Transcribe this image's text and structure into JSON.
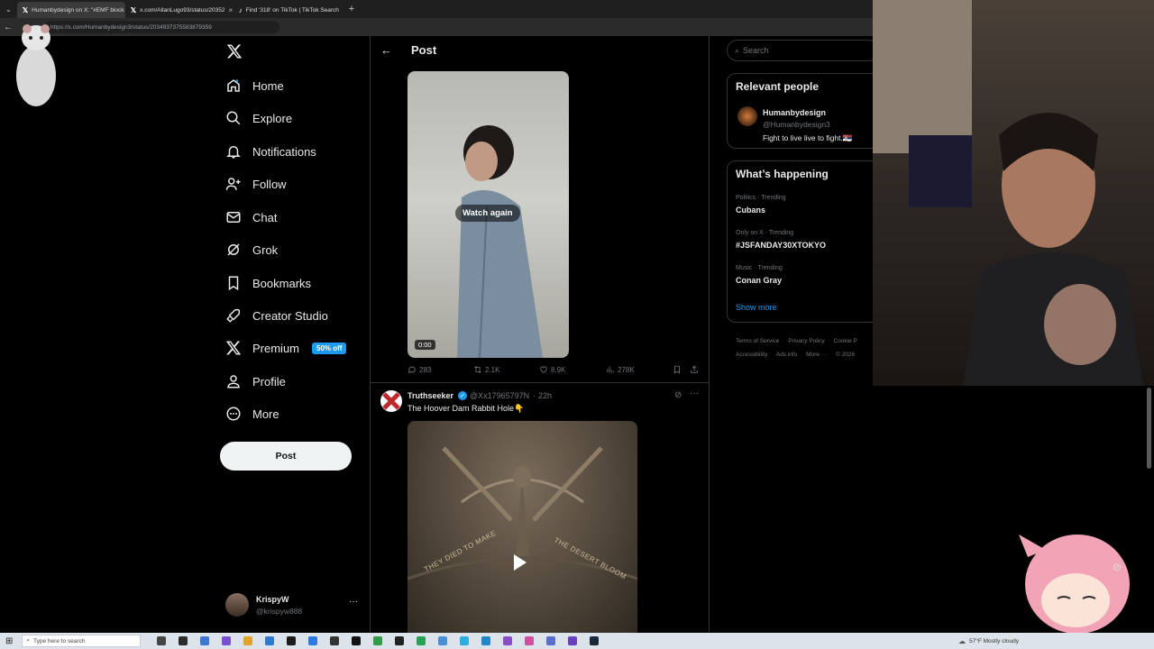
{
  "browser": {
    "tabs": [
      {
        "label": "Humanbydesign on X: \"#EMF block",
        "active": true
      },
      {
        "label": "x.com/AllanLugo93/status/20352",
        "active": false
      },
      {
        "label": "Find '318' on TikTok | TikTok Search",
        "active": false
      }
    ],
    "url": "https://x.com/Humanbydesign3/status/2034937375583879359"
  },
  "nav": {
    "items": [
      {
        "label": "Home",
        "icon": "home-icon"
      },
      {
        "label": "Explore",
        "icon": "search-icon"
      },
      {
        "label": "Notifications",
        "icon": "bell-icon"
      },
      {
        "label": "Follow",
        "icon": "follow-icon"
      },
      {
        "label": "Chat",
        "icon": "mail-icon"
      },
      {
        "label": "Grok",
        "icon": "grok-icon"
      },
      {
        "label": "Bookmarks",
        "icon": "bookmark-icon"
      },
      {
        "label": "Creator Studio",
        "icon": "rocket-icon"
      },
      {
        "label": "Premium",
        "icon": "x-logo-icon"
      },
      {
        "label": "Profile",
        "icon": "person-icon"
      },
      {
        "label": "More",
        "icon": "more-circle-icon"
      }
    ],
    "premium_badge": "50% off",
    "post_label": "Post",
    "account": {
      "name": "KrispyW",
      "handle": "@krispyw888"
    }
  },
  "header": {
    "title": "Post"
  },
  "video1": {
    "overlay": "Watch again",
    "time": "0:00"
  },
  "actions": {
    "replies": "283",
    "reposts": "2.1K",
    "likes": "8.9K",
    "views": "278K"
  },
  "post2": {
    "author": "Truthseeker",
    "handle": "@Xx17965797N",
    "time": "22h",
    "text": "The Hoover Dam Rabbit Hole👇",
    "media_text_left": "THEY DIED TO MAKE",
    "media_text_right": "THE DESERT BLOOM"
  },
  "search": {
    "placeholder": "Search"
  },
  "relevant": {
    "title": "Relevant people",
    "name": "Humanbydesign",
    "handle": "@Humanbydesign3",
    "bio": "Fight to live live to fight.🇷🇸"
  },
  "happening": {
    "title": "What’s happening",
    "trends": [
      {
        "meta": "Politics · Trending",
        "name": "Cubans"
      },
      {
        "meta": "Only on X · Trending",
        "name": "#JSFANDAY30XTOKYO"
      },
      {
        "meta": "Music · Trending",
        "name": "Conan Gray"
      }
    ],
    "show_more": "Show more"
  },
  "footer": {
    "links": [
      "Terms of Service",
      "Privacy Policy",
      "Cookie P",
      "Accessibility",
      "Ads info",
      "More ···",
      "© 2026"
    ]
  },
  "taskbar": {
    "search_placeholder": "Type here to search",
    "weather": "57°F  Mostly cloudy"
  },
  "colors": {
    "accent": "#1d9bf0",
    "background": "#000000",
    "border": "#2f3336",
    "muted": "#71767b"
  }
}
